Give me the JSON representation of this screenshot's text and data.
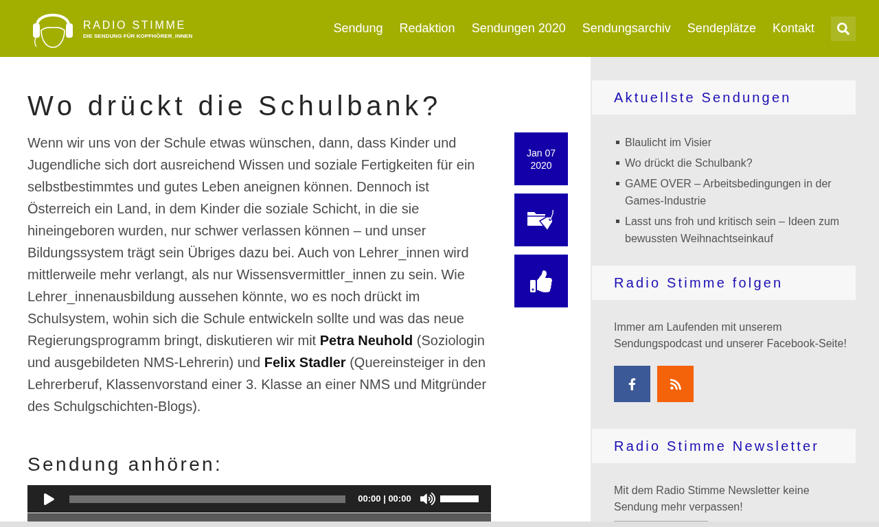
{
  "header": {
    "logo": {
      "title": "RADIO STIMME",
      "tagline": "DIE SENDUNG FÜR KOPFHÖRER_INNEN"
    },
    "nav": [
      {
        "label": "Sendung"
      },
      {
        "label": "Redaktion"
      },
      {
        "label": "Sendungen 2020"
      },
      {
        "label": "Sendungsarchiv"
      },
      {
        "label": "Sendeplätze"
      },
      {
        "label": "Kontakt"
      }
    ]
  },
  "article": {
    "title": "Wo drückt die Schulbank?",
    "body": "Wenn wir uns von der Schule etwas wünschen, dann, dass Kinder und Jugendliche sich dort ausreichend Wissen und soziale Fertigkeiten für ein selbstbestimmtes und gutes Leben aneignen können. Dennoch ist Österreich ein Land, in dem Kinder die soziale Schicht, in die sie hineingeboren wurden, nur schwer verlassen können – und unser Bildungssystem trägt sein Übriges dazu bei. Auch von Lehrer_innen wird mittlerweile mehr verlangt, als nur Wissensvermittler_innen zu sein. Wie Lehrer_innenausbildung aussehen könnte, wo es noch drückt im Schulsystem, wohin sich die Schule entwickeln sollte und was das neue Regierungsprogramm bringt, diskutieren wir mit **Petra Neuhold** (Soziologin und ausgebildeten NMS-Lehrerin) und **Felix Stadler** (Quereinsteiger in den Lehrerberuf, Klassenvorstand einer 3. Klasse an einer NMS und Mitgründer des Schulgschichten-Blogs).",
    "meta_tiles": [
      {
        "kind": "date",
        "day": "Jan 07",
        "year": "2020"
      },
      {
        "kind": "category"
      },
      {
        "kind": "like"
      }
    ],
    "listen_heading": "Sendung anhören:",
    "player": {
      "time": "00:00 | 00:00",
      "volume": {
        "level": 1
      }
    }
  },
  "sidebar": {
    "widgets": [
      {
        "kind": "posts",
        "title": "Aktuellste Sendungen",
        "items": [
          "Blaulicht im Visier",
          "Wo drückt die Schulbank?",
          "GAME OVER – Arbeitsbedingungen in der Games-Industrie",
          "Lasst uns froh und kritisch sein – Ideen zum bewussten Weihnachtseinkauf"
        ]
      },
      {
        "kind": "social",
        "title": "Radio Stimme folgen",
        "text": "Immer am Laufenden mit unserem Sendungspodcast und unserer Facebook-Seite!",
        "buttons": [
          {
            "kind": "facebook"
          },
          {
            "kind": "rss"
          }
        ]
      },
      {
        "kind": "newsletter",
        "title": "Radio Stimme Newsletter",
        "text": "Mit dem Radio Stimme Newsletter keine Sendung mehr verpassen!"
      }
    ]
  }
}
